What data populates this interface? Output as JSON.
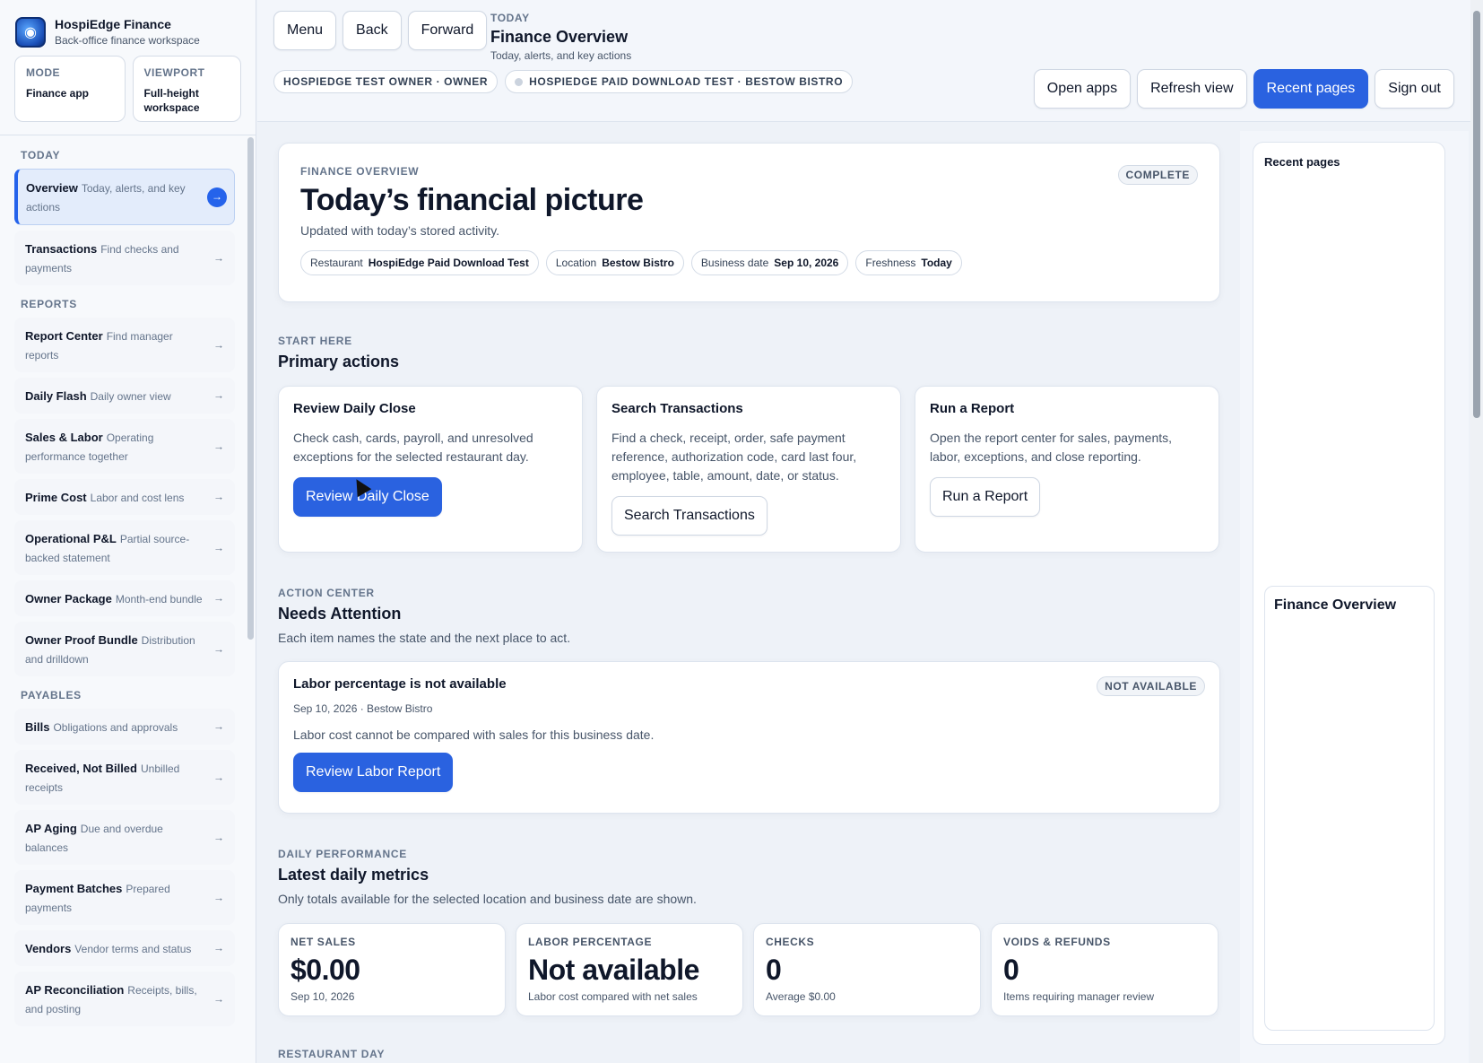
{
  "brand": {
    "title": "HospiEdge Finance",
    "subtitle": "Back-office finance workspace"
  },
  "mode": {
    "label": "MODE",
    "value": "Finance app"
  },
  "viewport": {
    "label": "VIEWPORT",
    "value": "Full-height workspace"
  },
  "sidebar": {
    "sections": [
      {
        "label": "TODAY",
        "items": [
          {
            "title": "Overview",
            "desc": "Today, alerts, and key actions",
            "active": true
          },
          {
            "title": "Transactions",
            "desc": "Find checks and payments"
          }
        ]
      },
      {
        "label": "REPORTS",
        "items": [
          {
            "title": "Report Center",
            "desc": "Find manager reports"
          },
          {
            "title": "Daily Flash",
            "desc": "Daily owner view"
          },
          {
            "title": "Sales & Labor",
            "desc": "Operating performance together"
          },
          {
            "title": "Prime Cost",
            "desc": "Labor and cost lens"
          },
          {
            "title": "Operational P&L",
            "desc": "Partial source-backed statement"
          },
          {
            "title": "Owner Package",
            "desc": "Month-end bundle"
          },
          {
            "title": "Owner Proof Bundle",
            "desc": "Distribution and drilldown"
          }
        ]
      },
      {
        "label": "PAYABLES",
        "items": [
          {
            "title": "Bills",
            "desc": "Obligations and approvals"
          },
          {
            "title": "Received, Not Billed",
            "desc": "Unbilled receipts"
          },
          {
            "title": "AP Aging",
            "desc": "Due and overdue balances"
          },
          {
            "title": "Payment Batches",
            "desc": "Prepared payments"
          },
          {
            "title": "Vendors",
            "desc": "Vendor terms and status"
          },
          {
            "title": "AP Reconciliation",
            "desc": "Receipts, bills, and posting"
          }
        ]
      }
    ]
  },
  "topbar": {
    "menu": "Menu",
    "back": "Back",
    "forward": "Forward",
    "kicker": "TODAY",
    "title": "Finance Overview",
    "subtitle": "Today, alerts, and key actions",
    "chip_owner": "HOSPIEDGE TEST OWNER · OWNER",
    "chip_location": "HOSPIEDGE PAID DOWNLOAD TEST · BESTOW BISTRO",
    "open_apps": "Open apps",
    "refresh": "Refresh view",
    "recent": "Recent pages",
    "sign_out": "Sign out"
  },
  "hero": {
    "kicker": "FINANCE OVERVIEW",
    "title": "Today’s financial picture",
    "subtitle": "Updated with today’s stored activity.",
    "badge": "COMPLETE",
    "tags": [
      {
        "label": "Restaurant",
        "value": "HospiEdge Paid Download Test"
      },
      {
        "label": "Location",
        "value": "Bestow Bistro"
      },
      {
        "label": "Business date",
        "value": "Sep 10, 2026"
      },
      {
        "label": "Freshness",
        "value": "Today"
      }
    ]
  },
  "primary": {
    "kicker": "START HERE",
    "title": "Primary actions",
    "cards": [
      {
        "title": "Review Daily Close",
        "desc": "Check cash, cards, payroll, and unresolved exceptions for the selected restaurant day.",
        "button": "Review Daily Close"
      },
      {
        "title": "Search Transactions",
        "desc": "Find a check, receipt, order, safe payment reference, authorization code, card last four, employee, table, amount, date, or status.",
        "button": "Search Transactions"
      },
      {
        "title": "Run a Report",
        "desc": "Open the report center for sales, payments, labor, exceptions, and close reporting.",
        "button": "Run a Report"
      }
    ]
  },
  "attention": {
    "kicker": "ACTION CENTER",
    "title": "Needs Attention",
    "subtitle": "Each item names the state and the next place to act.",
    "item": {
      "title": "Labor percentage is not available",
      "badge": "NOT AVAILABLE",
      "meta": "Sep 10, 2026 · Bestow Bistro",
      "desc": "Labor cost cannot be compared with sales for this business date.",
      "button": "Review Labor Report"
    }
  },
  "metrics": {
    "kicker": "DAILY PERFORMANCE",
    "title": "Latest daily metrics",
    "subtitle": "Only totals available for the selected location and business date are shown.",
    "cards": [
      {
        "label": "NET SALES",
        "value": "$0.00",
        "sub": "Sep 10, 2026"
      },
      {
        "label": "LABOR PERCENTAGE",
        "value": "Not available",
        "sub": "Labor cost compared with net sales"
      },
      {
        "label": "CHECKS",
        "value": "0",
        "sub": "Average $0.00"
      },
      {
        "label": "VOIDS & REFUNDS",
        "value": "0",
        "sub": "Items requiring manager review"
      }
    ]
  },
  "next_section": "RESTAURANT DAY",
  "recent_panel": {
    "title": "Recent pages",
    "item": "Finance Overview"
  }
}
